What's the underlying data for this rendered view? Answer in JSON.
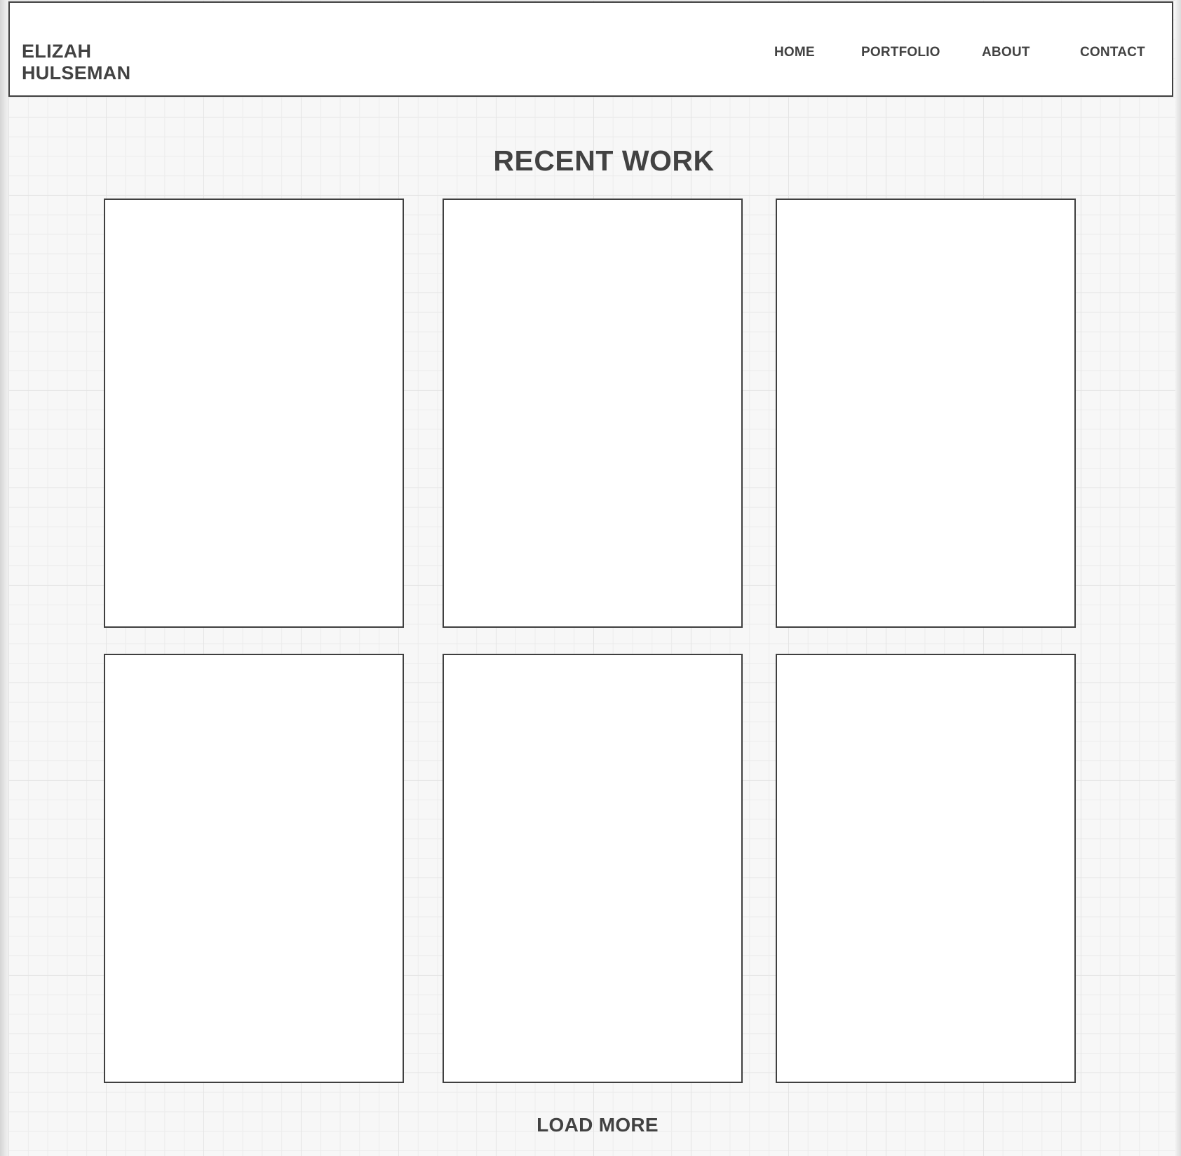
{
  "header": {
    "logo_line1": "ELIZAH",
    "logo_line2": "HULSEMAN",
    "nav": {
      "home": "HOME",
      "portfolio": "PORTFOLIO",
      "about": "ABOUT",
      "contact": "CONTACT"
    }
  },
  "main": {
    "section_title": "RECENT WORK",
    "portfolio_cards_count": 6,
    "load_more_label": "LOAD MORE"
  }
}
